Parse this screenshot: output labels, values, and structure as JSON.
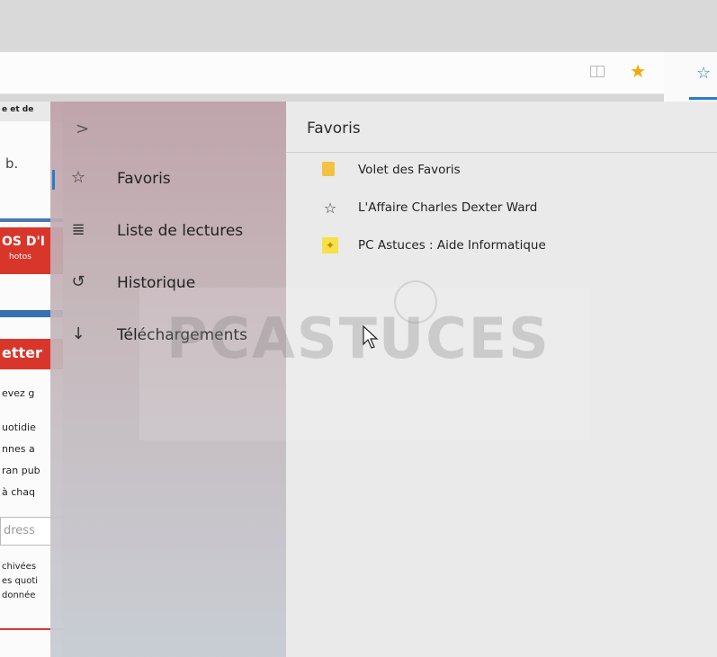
{
  "toolbar": {
    "reading_view_icon": "book-icon",
    "favorite_icon": "star-icon",
    "hub_icon": "hub-star-icon"
  },
  "page_behind": {
    "fragments": [
      "e et de",
      "b.",
      "OS D'I",
      "hotos",
      "etter",
      "evez g",
      "uotidie",
      "nnes a",
      "ran pub",
      "à chaq",
      "dress",
      "chivées",
      "es quoti",
      "donnée"
    ]
  },
  "hub": {
    "chevron": ">",
    "nav": [
      {
        "label": "Favoris",
        "icon": "☆",
        "selected": true
      },
      {
        "label": "Liste de lectures",
        "icon": "≣",
        "selected": false
      },
      {
        "label": "Historique",
        "icon": "↺",
        "selected": false
      },
      {
        "label": "Téléchargements",
        "icon": "↓",
        "selected": false
      }
    ]
  },
  "content": {
    "title": "Favoris",
    "items": [
      {
        "label": "Volet des Favoris",
        "icon": "folder-icon"
      },
      {
        "label": "L'Affaire Charles Dexter Ward",
        "icon": "star-icon"
      },
      {
        "label": "PC Astuces : Aide Informatique",
        "icon": "site-favicon"
      }
    ]
  },
  "watermark": {
    "text": "PCASTUCES"
  },
  "colors": {
    "accent": "#2a7cc7",
    "star": "#f2a900",
    "folder": "#f4c242",
    "red_banner": "#d9362b"
  }
}
